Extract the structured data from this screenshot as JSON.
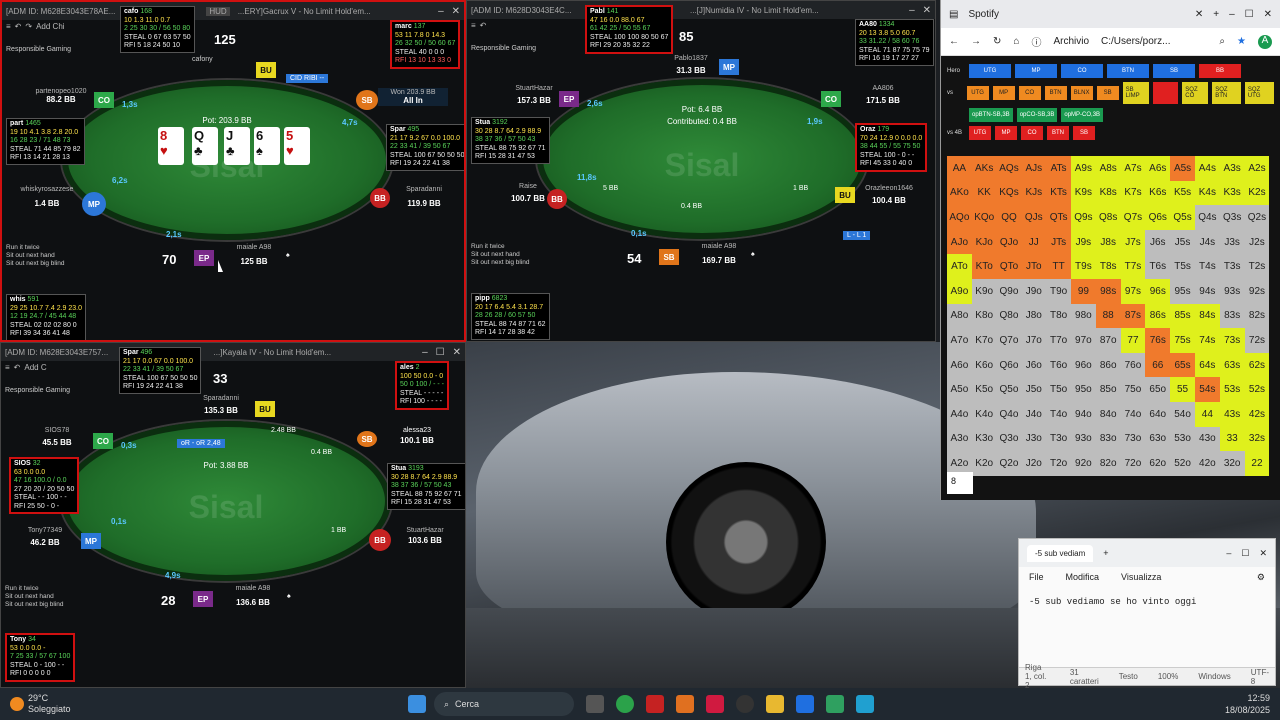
{
  "tables": [
    {
      "title": "[ADM ID: M628E3043E78AE...",
      "subtitle": "...ERY]Gacrux V - No Limit Hold'em...",
      "hud_tag": "HUD",
      "toolbar": "Add Chi",
      "responsible": "Responsible Gaming",
      "pot": "Pot: 203.9 BB",
      "won": "Won 203.9 BB",
      "allin": "All In",
      "big_number": "125",
      "table_number": "70",
      "timer": "6,2s",
      "call_banner": "CID RIBI --",
      "options": [
        "Run it twice",
        "Sit out next hand",
        "Sit out next big blind"
      ],
      "seats": [
        {
          "name": "cafony",
          "stack": "",
          "pos": "BU"
        },
        {
          "name": "partenopeo1020",
          "stack": "88.2 BB",
          "pos": "CO",
          "time": "1,3s"
        },
        {
          "name": "whiskyrosazzese",
          "stack": "1.4 BB",
          "pos": "MP"
        },
        {
          "name": "maiale A98",
          "stack": "125 BB",
          "pos": "EP",
          "time": "2,1s"
        },
        {
          "name": "Sparadanni",
          "stack": "119.9 BB",
          "pos": "BB"
        },
        {
          "name": "marc",
          "stack": "",
          "pos": "SB",
          "time": "4,7s"
        }
      ],
      "board": [
        {
          "r": "8",
          "s": "♥",
          "red": true
        },
        {
          "r": "?",
          "s": "♣",
          "red": false
        },
        {
          "r": "?",
          "s": "♣",
          "red": false
        },
        {
          "r": "6",
          "s": "♠",
          "red": false
        },
        {
          "r": "5",
          "s": "♥",
          "red": true
        }
      ],
      "huds": [
        {
          "name": "cafo",
          "id": "168",
          "stats": [
            "10 1.3 11.0 0.7",
            "2 25 30 30 / 56 50 80",
            "STEAL 0 67 63 57 50",
            "RFI 5 18 24 50 10"
          ]
        },
        {
          "name": "marc",
          "id": "137",
          "stats": [
            "53 11 7.8 0 14.3",
            "26 32 50 / 50 60 67",
            "STEAL 40 0 0 0",
            "RFI 13 10 13 33 0"
          ]
        },
        {
          "name": "part",
          "id": "1465",
          "stats": [
            "19 10 4.1 3.8 2.8 20.0",
            "16 28 23 / 71 48 73",
            "STEAL 71 44 85 79 82",
            "RFI 13 14 21 28 13"
          ]
        },
        {
          "name": "Spar",
          "id": "495",
          "stats": [
            "21 17 9.2 67 0.0 100.0",
            "22 33 41 / 39 50 67",
            "STEAL 100 67 50 50 50",
            "RFI 19 24 22 41 38"
          ]
        },
        {
          "name": "whis",
          "id": "591",
          "stats": [
            "29 25 10.7 7.4 2.9 23.0",
            "12 19 24.7 / 45 44 48",
            "STEAL 02 02 02 80 0",
            "RFI 39 34 36 41 48"
          ]
        }
      ]
    },
    {
      "title": "[ADM ID: M628D3043E4C...",
      "subtitle": "...[J]Numidia IV - No Limit Hold'em...",
      "toolbar": "",
      "responsible": "Responsible Gaming",
      "pot": "Pot: 6.4 BB",
      "contributed": "Contributed: 0.4 BB",
      "big_number": "85",
      "table_number": "54",
      "raise_label": "Raise",
      "raise_amount": "100.7 BB",
      "timer": "11,8s",
      "timer_amount": "5 BB",
      "mid_amount": "0.4 BB",
      "bb_amount": "1 BB",
      "options": [
        "Run it twice",
        "Sit out next hand",
        "Sit out next big blind"
      ],
      "l_tag": "L - L 1",
      "seats": [
        {
          "name": "Pablo1837",
          "stack": "31.3 BB",
          "pos": "MP"
        },
        {
          "name": "StuartHazar",
          "stack": "157.3 BB",
          "pos": "EP",
          "time": "2,6s"
        },
        {
          "name": "AA806",
          "stack": "171.5 BB",
          "pos": "CO",
          "time": "1,9s"
        },
        {
          "name": "maiale A98",
          "stack": "169.7 BB",
          "pos": "SB",
          "time": "0,1s"
        },
        {
          "name": "Orazleeon1646",
          "stack": "100.4 BB",
          "pos": "BU"
        }
      ],
      "huds": [
        {
          "name": "Pabl",
          "id": "141",
          "stats": [
            "47 16 0.0 88.0 67",
            "61 42 25 / 50 55 67",
            "STEAL 100 100 80 50 67",
            "RFI 29 20 35 32 22"
          ]
        },
        {
          "name": "AA80",
          "id": "1334",
          "stats": [
            "20 13 3.8 5.0 60.7",
            "33 31.22 / 58 60 76",
            "STEAL 71 87 75 75 79",
            "RFI 16 19 17 27 27"
          ]
        },
        {
          "name": "Stua",
          "id": "3192",
          "stats": [
            "30 28 8.7 64 2.9 88.9",
            "38 37 36 / 57 50 43",
            "STEAL 88 75 92 67 71",
            "RFI 15 28 31 47 53"
          ]
        },
        {
          "name": "Oraz",
          "id": "179",
          "stats": [
            "70 24 12.9 0 0.0 0.0",
            "38 44 55 / 55 75 50",
            "STEAL 100 - 0 - -",
            "RFI 45 33 0 40 0"
          ]
        },
        {
          "name": "pipp",
          "id": "6823",
          "stats": [
            "20 17 6.4 5.4 3.1 28.7",
            "28 26 28 / 60 57 50",
            "STEAL 88 74 87 71 62",
            "RFI 14 17 28 38 42"
          ]
        }
      ]
    },
    {
      "title": "[ADM ID: M628E3043E757...",
      "subtitle": "...]Kayala IV - No Limit Hold'em...",
      "toolbar": "Add C",
      "responsible": "Responsible Gaming",
      "pot": "Pot: 3.88 BB",
      "action": "oR - oR 2,48",
      "bet_amount": "2.48 BB",
      "sb_amount": "0.4 BB",
      "bb_amount": "1 BB",
      "big_number": "33",
      "table_number": "28",
      "options": [
        "Run it twice",
        "Sit out next hand",
        "Sit out next big blind"
      ],
      "seats": [
        {
          "name": "Sparadanni",
          "stack": "135.3 BB",
          "pos": "BU"
        },
        {
          "name": "SIOS78",
          "stack": "45.5 BB",
          "pos": "CO",
          "time": "0,3s"
        },
        {
          "name": "Tony77349",
          "stack": "46.2 BB",
          "pos": "MP",
          "time": "0,1s"
        },
        {
          "name": "maiale A98",
          "stack": "136.6 BB",
          "pos": "EP",
          "time": "4,9s"
        },
        {
          "name": "alessa23",
          "stack": "100.1 BB",
          "pos": "SB"
        },
        {
          "name": "StuartHazar",
          "stack": "103.6 BB",
          "pos": "BB"
        }
      ],
      "huds": [
        {
          "name": "Spar",
          "id": "496",
          "stats": [
            "21 17 0.0 67 0.0 100.0",
            "22 33 41 / 39 50 67",
            "STEAL 100 67 50 50 50",
            "RFI 19 24 22 41 38"
          ]
        },
        {
          "name": "ales",
          "id": "2",
          "stats": [
            "100 50 0.0 - 0",
            "50 0 100 / - - -",
            "STEAL - - - - -",
            "RFI 100 - - - -"
          ]
        },
        {
          "name": "SIOS",
          "id": "32",
          "stats": [
            "63 0.0 0.0",
            "47 16 100.0 / 0.0",
            "27 20 20 / 20 50 50",
            "STEAL - - 100 - -",
            "RFI 25 50 - 0 -"
          ]
        },
        {
          "name": "Stua",
          "id": "3193",
          "stats": [
            "30 28 8.7 64 2.9 88.9",
            "38 37 36 / 57 50 43",
            "STEAL 88 75 92 67 71",
            "RFI 15 28 31 47 53"
          ]
        },
        {
          "name": "Tony",
          "id": "34",
          "stats": [
            "53 0.0 0.0 -",
            "7 25 33 / 57 67 100",
            "STEAL 0 - 100 - -",
            "RFI 0 0 0 0 0"
          ]
        }
      ]
    }
  ],
  "spotify": {
    "tab_title": "Spotify",
    "address_label": "Archivio",
    "address_path": "C:/Users/porz...",
    "hero_label": "Hero",
    "hero_buttons": [
      "UTG",
      "MP",
      "CO",
      "BTN",
      "SB",
      "BB"
    ],
    "vs_label": "vs",
    "vs_buttons": [
      "UTG",
      "MP",
      "CO",
      "BTN",
      "BLNX",
      "SB",
      "SB LIMP",
      "",
      "SQZ CO",
      "SQZ BTN",
      "SQZ UTG"
    ],
    "row3_buttons": [
      "opBTN-SB,3B",
      "opCO-SB,3B",
      "opMP-CO,3B"
    ],
    "row4_label": "vs 4B",
    "row4_buttons": [
      "UTG",
      "MP",
      "CO",
      "BTN",
      "SB"
    ],
    "input_value": "8",
    "grid": [
      [
        "AA",
        "AKs",
        "AQs",
        "AJs",
        "ATs",
        "A9s",
        "A8s",
        "A7s",
        "A6s",
        "A5s",
        "A4s",
        "A3s",
        "A2s"
      ],
      [
        "AKo",
        "KK",
        "KQs",
        "KJs",
        "KTs",
        "K9s",
        "K8s",
        "K7s",
        "K6s",
        "K5s",
        "K4s",
        "K3s",
        "K2s"
      ],
      [
        "AQo",
        "KQo",
        "QQ",
        "QJs",
        "QTs",
        "Q9s",
        "Q8s",
        "Q7s",
        "Q6s",
        "Q5s",
        "Q4s",
        "Q3s",
        "Q2s"
      ],
      [
        "AJo",
        "KJo",
        "QJo",
        "JJ",
        "JTs",
        "J9s",
        "J8s",
        "J7s",
        "J6s",
        "J5s",
        "J4s",
        "J3s",
        "J2s"
      ],
      [
        "ATo",
        "KTo",
        "QTo",
        "JTo",
        "TT",
        "T9s",
        "T8s",
        "T7s",
        "T6s",
        "T5s",
        "T4s",
        "T3s",
        "T2s"
      ],
      [
        "A9o",
        "K9o",
        "Q9o",
        "J9o",
        "T9o",
        "99",
        "98s",
        "97s",
        "96s",
        "95s",
        "94s",
        "93s",
        "92s"
      ],
      [
        "A8o",
        "K8o",
        "Q8o",
        "J8o",
        "T8o",
        "98o",
        "88",
        "87s",
        "86s",
        "85s",
        "84s",
        "83s",
        "82s"
      ],
      [
        "A7o",
        "K7o",
        "Q7o",
        "J7o",
        "T7o",
        "97o",
        "87o",
        "77",
        "76s",
        "75s",
        "74s",
        "73s",
        "72s"
      ],
      [
        "A6o",
        "K6o",
        "Q6o",
        "J6o",
        "T6o",
        "96o",
        "86o",
        "76o",
        "66",
        "65s",
        "64s",
        "63s",
        "62s"
      ],
      [
        "A5o",
        "K5o",
        "Q5o",
        "J5o",
        "T5o",
        "95o",
        "85o",
        "75o",
        "65o",
        "55",
        "54s",
        "53s",
        "52s"
      ],
      [
        "A4o",
        "K4o",
        "Q4o",
        "J4o",
        "T4o",
        "94o",
        "84o",
        "74o",
        "64o",
        "54o",
        "44",
        "43s",
        "42s"
      ],
      [
        "A3o",
        "K3o",
        "Q3o",
        "J3o",
        "T3o",
        "93o",
        "83o",
        "73o",
        "63o",
        "53o",
        "43o",
        "33",
        "32s"
      ],
      [
        "A2o",
        "K2o",
        "Q2o",
        "J2o",
        "T2o",
        "92o",
        "82o",
        "72o",
        "62o",
        "52o",
        "42o",
        "32o",
        "22"
      ]
    ],
    "grid_colors": [
      "OOOOOYYYYOYYY",
      "OOOOOYYYYYYYY",
      "OOOOOYYYYYGGG",
      "OOOOOYYYGGGGG",
      "YOOOOYYYGGGGG",
      "YGGGGOOYYGGGG",
      "GGGGGGOOYYYGG",
      "GGGGGGGYOYYYG",
      "GGGGGGGGOOYYY",
      "GGGGGGGGGYOYY",
      "GGGGGGGGGGYYY",
      "GGGGGGGGGGGYY",
      "GGGGGGGGGGGGY"
    ]
  },
  "notepad": {
    "tab": "-5 sub vediam",
    "menu": [
      "File",
      "Modifica",
      "Visualizza"
    ],
    "text": "-5 sub vediamo se ho vinto oggi",
    "status": [
      "Riga 1, col. 2",
      "31 caratteri",
      "Testo",
      "100%",
      "Windows",
      "UTF-8"
    ]
  },
  "taskbar": {
    "temp": "29°C",
    "weather": "Soleggiato",
    "search": "Cerca",
    "time": "12:59",
    "date": "18/08/2025"
  }
}
